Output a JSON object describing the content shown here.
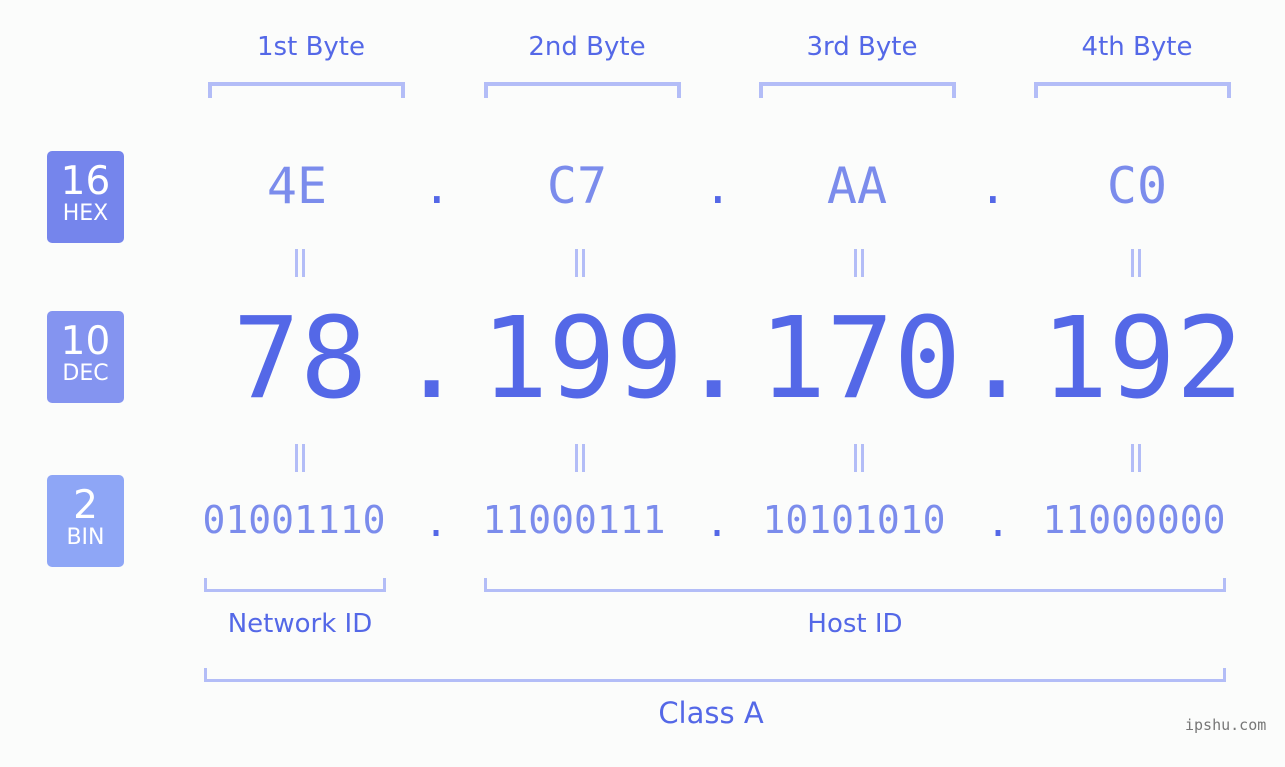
{
  "headers": [
    "1st Byte",
    "2nd Byte",
    "3rd Byte",
    "4th Byte"
  ],
  "badges": [
    {
      "num": "16",
      "label": "HEX",
      "color": "#7585ec"
    },
    {
      "num": "10",
      "label": "DEC",
      "color": "#8494f0"
    },
    {
      "num": "2",
      "label": "BIN",
      "color": "#8ea6f6"
    }
  ],
  "hex": [
    "4E",
    "C7",
    "AA",
    "C0"
  ],
  "dec": [
    "78",
    "199",
    "170",
    "192"
  ],
  "bin": [
    "01001110",
    "11000111",
    "10101010",
    "11000000"
  ],
  "separator": ".",
  "network_id_label": "Network ID",
  "host_id_label": "Host ID",
  "class_label": "Class A",
  "watermark": "ipshu.com",
  "colors": {
    "primary": "#5468e7",
    "light": "#7b8cec",
    "bracket": "#b3bdf7"
  }
}
